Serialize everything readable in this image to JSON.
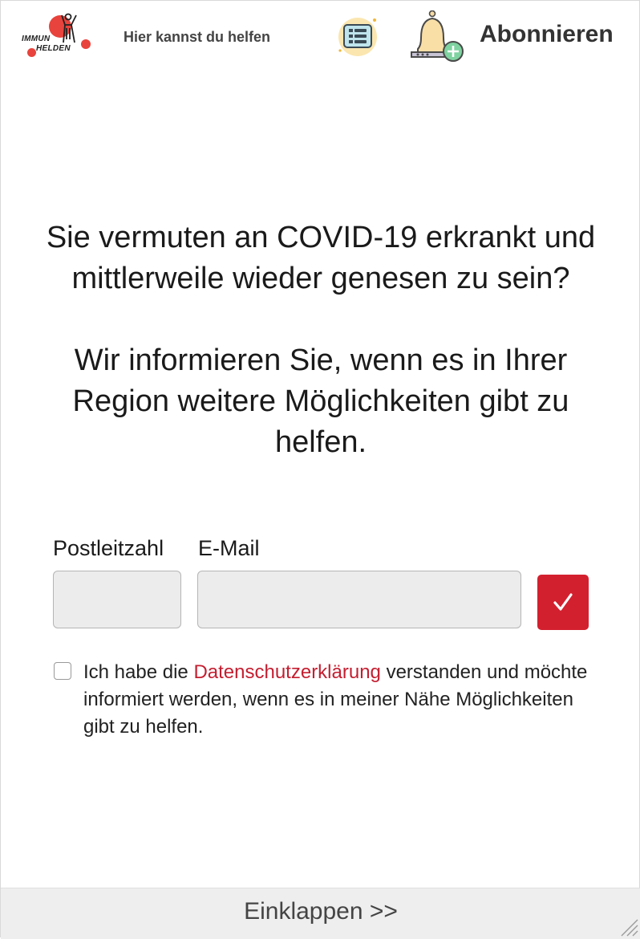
{
  "header": {
    "logo_line1": "IMMUN",
    "logo_line2": "HELDEN",
    "help_link": "Hier kannst du helfen",
    "list_icon": "list-icon",
    "bell_icon": "bell-plus-icon",
    "subscribe_label": "Abonnieren"
  },
  "headline": {
    "question": "Sie vermuten an COVID-19 erkrankt und mittlerweile wieder genesen zu sein?",
    "info": "Wir informieren Sie, wenn es in Ihrer Region weitere Möglichkeiten gibt zu helfen."
  },
  "form": {
    "postal_label": "Postleitzahl",
    "postal_value": "",
    "email_label": "E-Mail",
    "email_value": "",
    "submit_icon": "check-icon",
    "consent_checked": false,
    "consent_prefix": "Ich habe die ",
    "consent_link": "Datenschutzerklärung",
    "consent_suffix": " verstanden und möchte informiert werden, wenn es in meiner Nähe Möglichkeiten gibt zu helfen."
  },
  "footer": {
    "collapse_label": "Einklappen >>"
  },
  "colors": {
    "accent_red": "#d3202f",
    "link_red": "#c41e30",
    "logo_red": "#e8433c",
    "footer_bg": "#eeeeee"
  }
}
